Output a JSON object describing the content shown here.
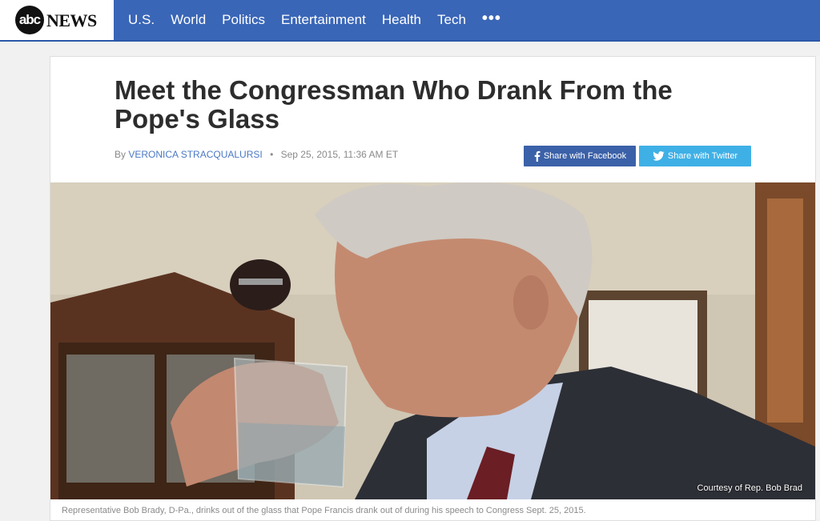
{
  "logo": {
    "abc": "abc",
    "news": "NEWS"
  },
  "nav": {
    "items": [
      "U.S.",
      "World",
      "Politics",
      "Entertainment",
      "Health",
      "Tech"
    ],
    "more": "•••"
  },
  "article": {
    "title": "Meet the Congressman Who Drank From the Pope's Glass",
    "by": "By",
    "author": "VERONICA STRACQUALURSI",
    "dot": "•",
    "date": "Sep 25, 2015, 11:36 AM ET",
    "share_facebook": "Share with Facebook",
    "share_twitter": "Share with Twitter",
    "photo_credit": "Courtesy of Rep. Bob Brad",
    "caption": "Representative Bob Brady, D-Pa., drinks out of the glass that Pope Francis drank out of during his speech to Congress Sept. 25, 2015."
  },
  "colors": {
    "nav_bg": "#3a66b7",
    "facebook": "#3b61a8",
    "twitter": "#3fb0e6",
    "author": "#4a78c4"
  },
  "icons": [
    "facebook-icon",
    "twitter-icon"
  ]
}
